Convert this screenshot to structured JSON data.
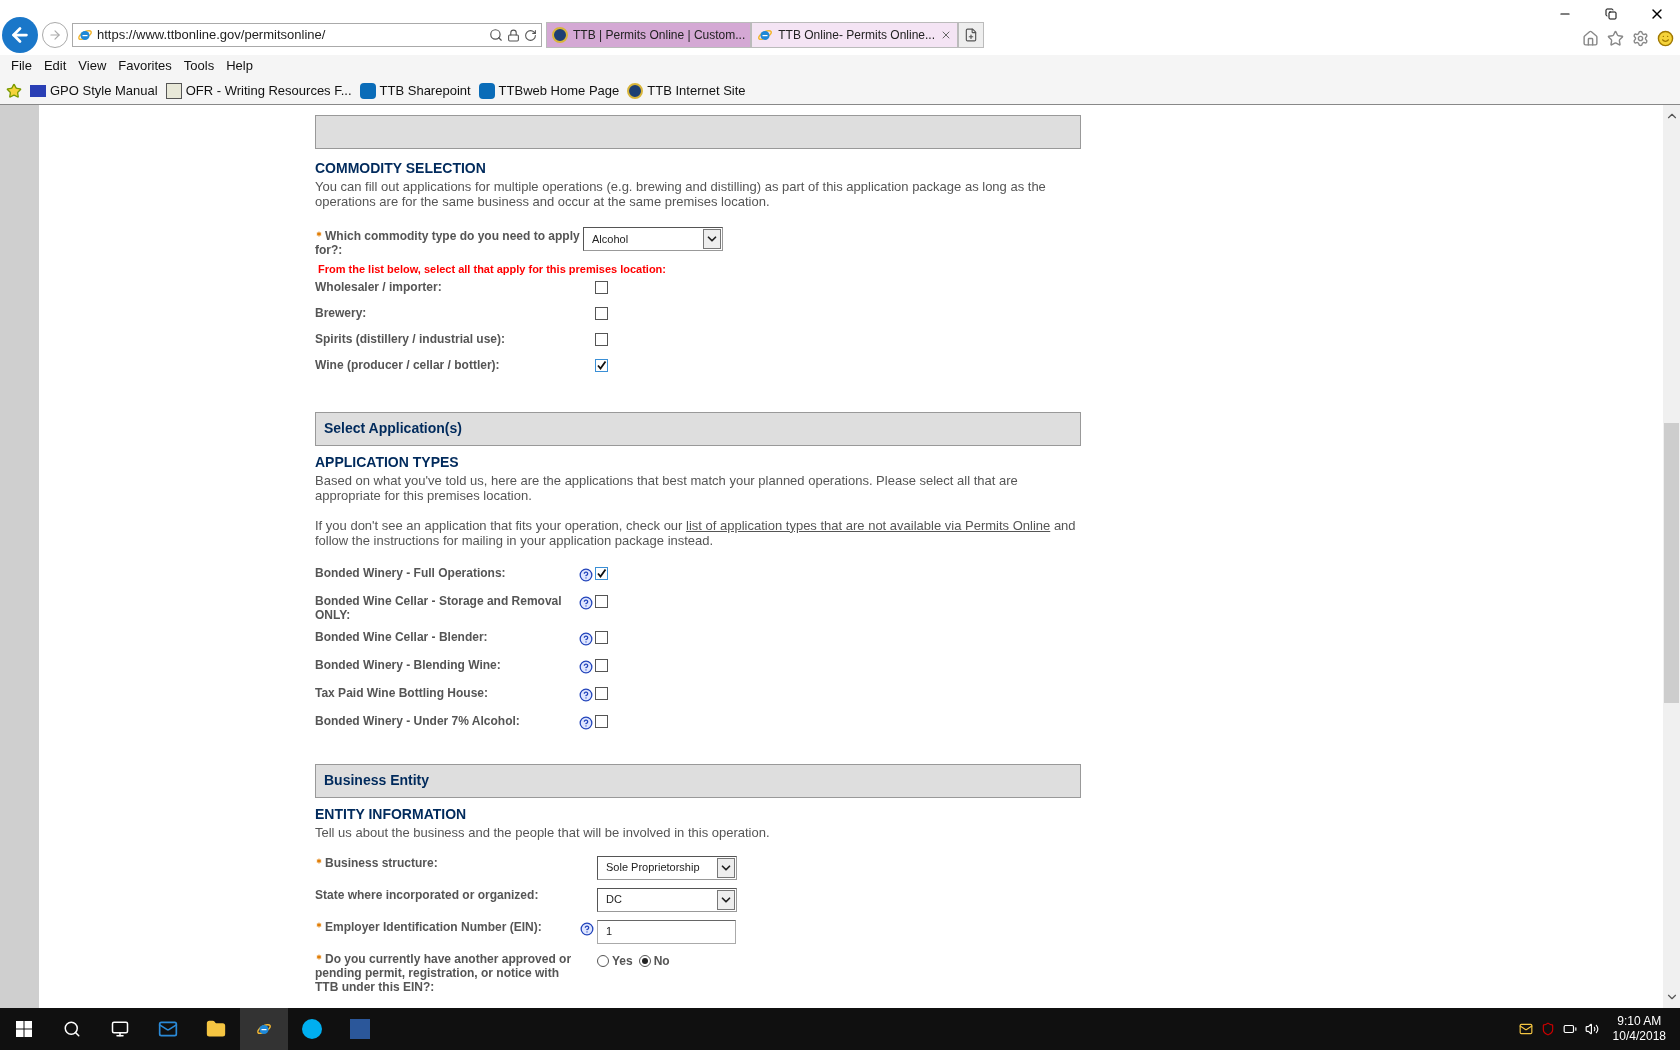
{
  "browser": {
    "address": "https://www.ttbonline.gov/permitsonline/",
    "tabs": [
      {
        "title": "TTB | Permits Online | Custom...",
        "selected": false,
        "kind": "seal"
      },
      {
        "title": "TTB Online- Permits Online...",
        "selected": true,
        "kind": "ie"
      }
    ],
    "menu": [
      "File",
      "Edit",
      "View",
      "Favorites",
      "Tools",
      "Help"
    ],
    "favorites": [
      {
        "label": "GPO Style Manual",
        "kind": "gpo"
      },
      {
        "label": "OFR - Writing Resources F...",
        "kind": "ofr"
      },
      {
        "label": "TTB Sharepoint",
        "kind": "sp"
      },
      {
        "label": "TTBweb Home Page",
        "kind": "sp"
      },
      {
        "label": "TTB Internet Site",
        "kind": "seal"
      }
    ]
  },
  "commodity": {
    "heading": "COMMODITY SELECTION",
    "intro": "You can fill out applications for multiple operations (e.g. brewing and distilling) as part of this application package as long as the operations are for the same business and occur at the same premises location.",
    "question": {
      "label": "Which commodity type do you need to apply for?:",
      "required": true,
      "value": "Alcohol"
    },
    "instruction": "From the list below, select all that apply for this premises location:",
    "options": [
      {
        "label": "Wholesaler / importer:",
        "checked": false
      },
      {
        "label": "Brewery:",
        "checked": false
      },
      {
        "label": "Spirits (distillery / industrial use):",
        "checked": false
      },
      {
        "label": "Wine (producer / cellar / bottler):",
        "checked": true
      }
    ]
  },
  "applications": {
    "title": "Select Application(s)",
    "heading": "APPLICATION TYPES",
    "intro": "Based on what you've told us, here are the applications that best match your planned operations. Please select all that are appropriate for this premises location.",
    "note_before": "If you don't see an application that fits your operation, check our",
    "note_link": "list of application types that are not available via Permits Online",
    "note_after": "and follow the instructions for mailing in your application package instead.",
    "options": [
      {
        "label": "Bonded Winery - Full Operations:",
        "checked": true
      },
      {
        "label": "Bonded Wine Cellar - Storage and Removal ONLY:",
        "checked": false
      },
      {
        "label": "Bonded Wine Cellar - Blender:",
        "checked": false
      },
      {
        "label": "Bonded Winery - Blending Wine:",
        "checked": false
      },
      {
        "label": "Tax Paid Wine Bottling House:",
        "checked": false
      },
      {
        "label": "Bonded Winery - Under 7% Alcohol:",
        "checked": false
      }
    ]
  },
  "entity": {
    "title": "Business Entity",
    "heading": "ENTITY INFORMATION",
    "intro": "Tell us about the business and the people that will be involved in this operation.",
    "fields": [
      {
        "kind": "select",
        "label": "Business structure:",
        "required": true,
        "help": false,
        "value": "Sole Proprietorship"
      },
      {
        "kind": "select",
        "label": "State where incorporated or organized:",
        "required": false,
        "help": false,
        "value": "DC"
      },
      {
        "kind": "text",
        "label": "Employer Identification Number (EIN):",
        "required": true,
        "help": true,
        "value": "1"
      },
      {
        "kind": "radio",
        "label": "Do you currently have another approved or pending permit, registration, or notice with TTB under this EIN?:",
        "required": true,
        "help": false,
        "choices": [
          {
            "label": "Yes",
            "selected": false
          },
          {
            "label": "No",
            "selected": true
          }
        ]
      }
    ]
  },
  "taskbar": {
    "time": "9:10 AM",
    "date": "10/4/2018"
  }
}
